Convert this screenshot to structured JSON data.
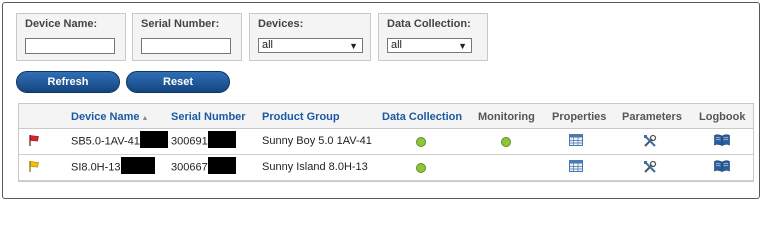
{
  "filters": {
    "device_name": {
      "label": "Device Name:",
      "value": ""
    },
    "serial_number": {
      "label": "Serial Number:",
      "value": ""
    },
    "devices": {
      "label": "Devices:",
      "selected": "all"
    },
    "data_collection": {
      "label": "Data Collection:",
      "selected": "all"
    }
  },
  "buttons": {
    "refresh": "Refresh",
    "reset": "Reset"
  },
  "table": {
    "headers": {
      "device_name": "Device Name",
      "sort_arrow": "▲",
      "serial_number": "Serial Number",
      "product_group": "Product Group",
      "data_collection": "Data Collection",
      "monitoring": "Monitoring",
      "properties": "Properties",
      "parameters": "Parameters",
      "logbook": "Logbook"
    },
    "rows": [
      {
        "flag_color": "#d7262f",
        "device_name": "SB5.0-1AV-41",
        "serial_number": "300691",
        "product_group": "Sunny Boy 5.0 1AV-41",
        "data_collection": true,
        "monitoring": true
      },
      {
        "flag_color": "#f2c200",
        "device_name": "SI8.0H-13",
        "serial_number": "300667",
        "product_group": "Sunny Island 8.0H-13",
        "data_collection": true,
        "monitoring": false
      }
    ]
  },
  "icons": {
    "flag": "flag-icon",
    "properties": "table-grid-icon",
    "parameters": "tools-icon",
    "logbook": "book-icon"
  },
  "colors": {
    "button": "#1f5a9a",
    "link": "#1b5aa3",
    "status_ok": "#8fc53c"
  }
}
